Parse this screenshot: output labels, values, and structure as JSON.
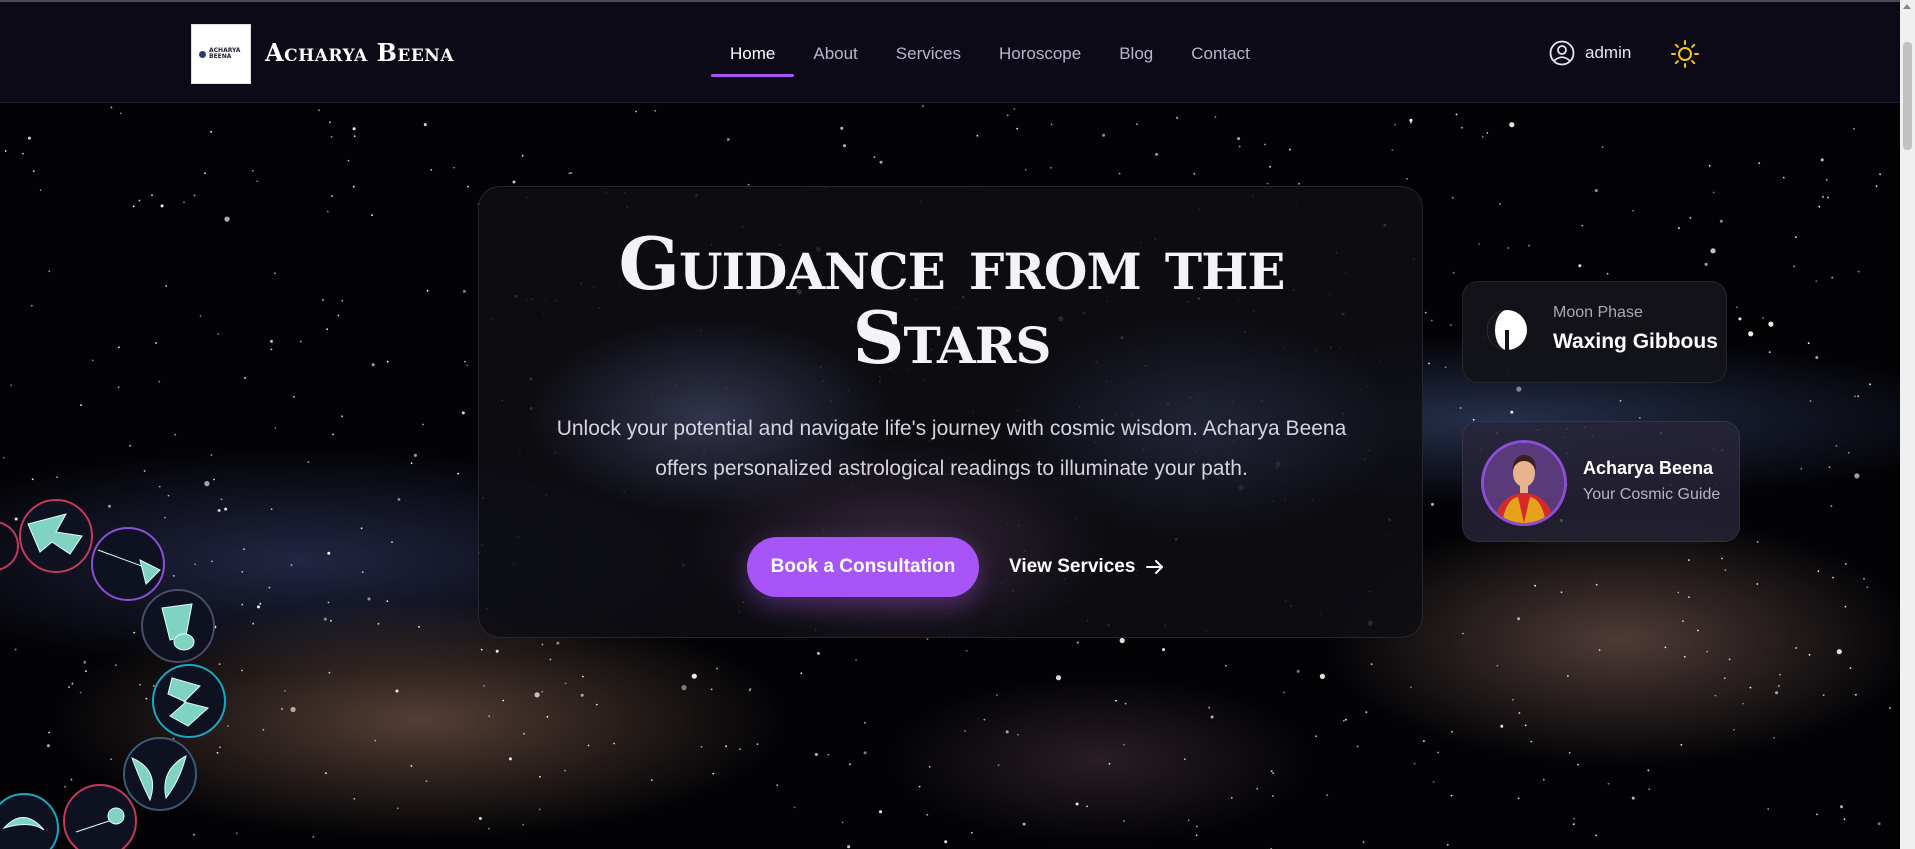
{
  "brand": {
    "name": "Acharya Beena",
    "logo_text": "ACHARYA BEENA"
  },
  "nav": {
    "items": [
      {
        "label": "Home",
        "active": true
      },
      {
        "label": "About",
        "active": false
      },
      {
        "label": "Services",
        "active": false
      },
      {
        "label": "Horoscope",
        "active": false
      },
      {
        "label": "Blog",
        "active": false
      },
      {
        "label": "Contact",
        "active": false
      }
    ],
    "user_label": "admin",
    "user_icon": "user-circle-icon",
    "theme_icon": "sun-icon"
  },
  "hero": {
    "title_line1": "Guidance from the",
    "title_line2": "Stars",
    "description": "Unlock your potential and navigate life's journey with cosmic wisdom. Acharya Beena offers personalized astrological readings to illuminate your path.",
    "primary_button": "Book a Consultation",
    "secondary_button": "View Services",
    "secondary_icon": "arrow-right-icon"
  },
  "moon": {
    "label": "Moon Phase",
    "value": "Waxing Gibbous",
    "icon": "moon-phase-icon"
  },
  "guide": {
    "name": "Acharya Beena",
    "subtitle": "Your Cosmic Guide"
  },
  "colors": {
    "accent": "#a855f7",
    "nav_bg": "#0b0a16",
    "sun": "#f5c518"
  }
}
